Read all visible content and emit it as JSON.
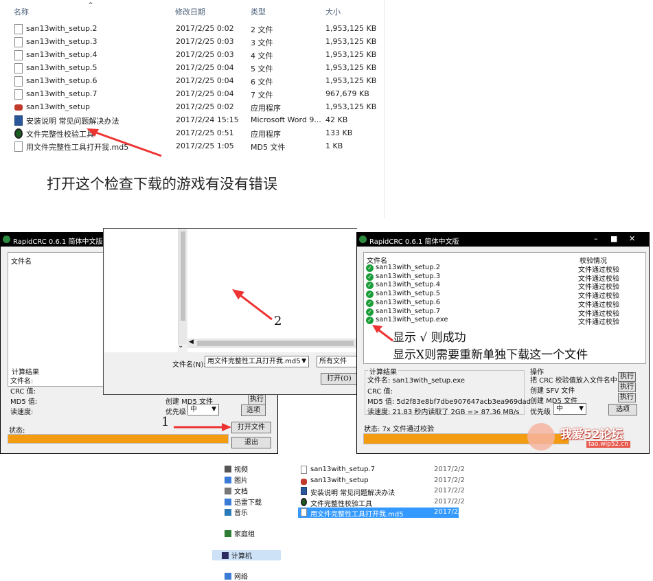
{
  "explorer": {
    "columns": {
      "name": "名称",
      "date": "修改日期",
      "type": "类型",
      "size": "大小"
    },
    "files": [
      {
        "name": "san13with_setup.2",
        "date": "2017/2/25 0:02",
        "type": "2 文件",
        "size": "1,953,125 KB",
        "icon": "file-icon"
      },
      {
        "name": "san13with_setup.3",
        "date": "2017/2/25 0:03",
        "type": "3 文件",
        "size": "1,953,125 KB",
        "icon": "file-icon"
      },
      {
        "name": "san13with_setup.4",
        "date": "2017/2/25 0:03",
        "type": "4 文件",
        "size": "1,953,125 KB",
        "icon": "file-icon"
      },
      {
        "name": "san13with_setup.5",
        "date": "2017/2/25 0:04",
        "type": "5 文件",
        "size": "1,953,125 KB",
        "icon": "file-icon"
      },
      {
        "name": "san13with_setup.6",
        "date": "2017/2/25 0:04",
        "type": "6 文件",
        "size": "1,953,125 KB",
        "icon": "file-icon"
      },
      {
        "name": "san13with_setup.7",
        "date": "2017/2/25 0:04",
        "type": "7 文件",
        "size": "967,679 KB",
        "icon": "file-icon"
      },
      {
        "name": "san13with_setup",
        "date": "2017/2/25 0:02",
        "type": "应用程序",
        "size": "1,953,125 KB",
        "icon": "setup-app-icon"
      },
      {
        "name": "安装说明 常见问题解决办法",
        "date": "2017/2/24 15:15",
        "type": "Microsoft Word 9...",
        "size": "42 KB",
        "icon": "word-doc-icon"
      },
      {
        "name": "文件完整性校验工具",
        "date": "2017/2/25 0:51",
        "type": "应用程序",
        "size": "133 KB",
        "icon": "rapidcrc-app-icon"
      },
      {
        "name": "用文件完整性工具打开我.md5",
        "date": "2017/2/25 1:05",
        "type": "MD5 文件",
        "size": "1 KB",
        "icon": "file-icon"
      }
    ],
    "note": "打开这个检查下载的游戏有没有错误"
  },
  "left_window": {
    "title": "RapidCRC 0.6.1 简体中文版",
    "list_header": "文件名",
    "results_title": "计算结果",
    "fields": [
      "文件名:",
      "CRC 值:",
      "MD5 值:",
      "读速度:"
    ],
    "md5_checkbox_label": "创建 MD5 文件",
    "exec_label": "执行",
    "priority_label": "优先级",
    "priority_value": "中",
    "options_label": "选项",
    "status_label": "状态:",
    "open_file_label": "打开文件",
    "exit_label": "退出",
    "step_number": "1",
    "progress_fraction": 1.0
  },
  "open_dialog": {
    "nav": [
      {
        "label": "视频",
        "icon": "video-folder-icon"
      },
      {
        "label": "图片",
        "icon": "pictures-folder-icon"
      },
      {
        "label": "文档",
        "icon": "documents-folder-icon"
      },
      {
        "label": "迅雷下载",
        "icon": "download-folder-icon"
      },
      {
        "label": "音乐",
        "icon": "music-folder-icon"
      },
      {
        "label": "家庭组",
        "icon": "homegroup-icon"
      },
      {
        "label": "计算机",
        "icon": "computer-icon"
      },
      {
        "label": "网络",
        "icon": "network-icon"
      }
    ],
    "files": [
      {
        "name": "san13with_setup.7",
        "date": "2017/2/2",
        "icon": "file-icon"
      },
      {
        "name": "san13with_setup",
        "date": "2017/2/2",
        "icon": "setup-app-icon"
      },
      {
        "name": "安装说明 常见问题解决办法",
        "date": "2017/2/2",
        "icon": "word-doc-icon"
      },
      {
        "name": "文件完整性校验工具",
        "date": "2017/2/2",
        "icon": "rapidcrc-app-icon"
      },
      {
        "name": "用文件完整性工具打开我.md5",
        "date": "2017/2/2",
        "icon": "file-icon"
      }
    ],
    "filename_label": "文件名(N):",
    "filename_value": "用文件完整性工具打开我.md5",
    "filter_value": "所有文件",
    "open_button": "打开(O)",
    "step_number": "2"
  },
  "right_window": {
    "title": "RapidCRC 0.6.1 简体中文版",
    "window_controls": {
      "minimize": "–",
      "maximize": "■",
      "close": "✕"
    },
    "list_header": "文件名",
    "status_header": "校验情况",
    "rows": [
      {
        "name": "san13with_setup.2",
        "status": "文件通过校验"
      },
      {
        "name": "san13with_setup.3",
        "status": "文件通过校验"
      },
      {
        "name": "san13with_setup.4",
        "status": "文件通过校验"
      },
      {
        "name": "san13with_setup.5",
        "status": "文件通过校验"
      },
      {
        "name": "san13with_setup.6",
        "status": "文件通过校验"
      },
      {
        "name": "san13with_setup.7",
        "status": "文件通过校验"
      },
      {
        "name": "san13with_setup.exe",
        "status": "文件通过校验"
      }
    ],
    "note_success": "显示 √ 则成功",
    "note_fail": "显示X则需要重新单独下载这一个文件",
    "results_title": "计算结果",
    "filename_line": "文件名: san13with_setup.exe",
    "crc_line": "CRC 值:",
    "md5_line": "MD5 值: 5d2f83e8bf7dbe907647acb3ea969dad",
    "speed_line": "读速度: 21.83 秒内读取了 2GB => 87.36 MB/s",
    "ops_title": "操作",
    "ops": [
      {
        "label": "把 CRC 校验值放入文件名中",
        "button": "执行"
      },
      {
        "label": "创建 SFV 文件",
        "button": "执行"
      },
      {
        "label": "创建 MD5 文件",
        "button": "执行"
      }
    ],
    "priority_label": "优先级",
    "priority_value": "中",
    "options_label": "选项",
    "status_text": "状态:  7x 文件通过校验",
    "progress_fraction": 1.0
  },
  "watermark": {
    "text": "我爱52论坛",
    "url": "tao.wip52.cn"
  },
  "colors": {
    "progress": "#f39c12",
    "arrow": "#e33333",
    "check": "#1b9e3a"
  }
}
